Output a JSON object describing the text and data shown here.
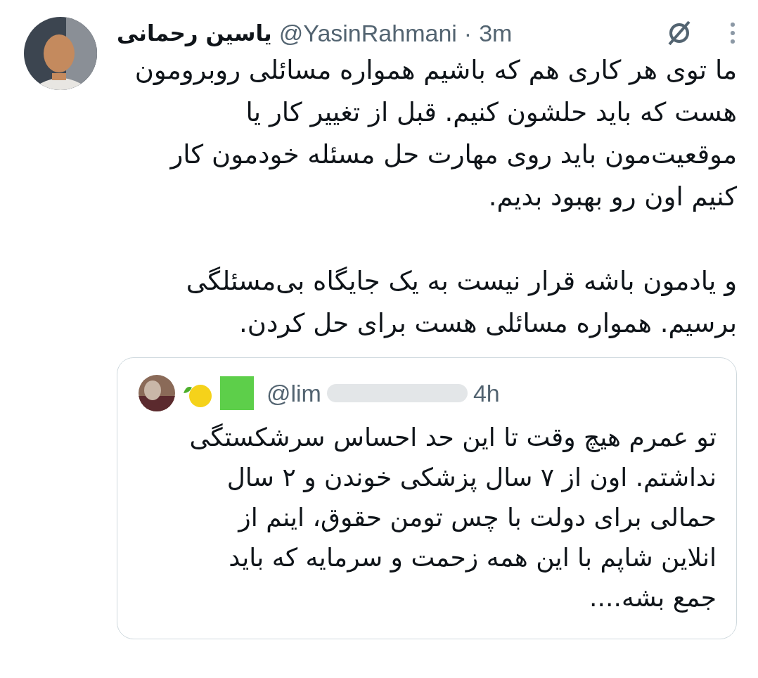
{
  "tweet": {
    "name": "یاسین رحمانی",
    "handle": "@YasinRahmani",
    "separator": "·",
    "time": "3m",
    "paragraphs": [
      "ما توی هر کاری هم که باشیم همواره مسائلی روبرومون\nهست که باید حلشون کنیم. قبل از تغییر کار یا\nموقعیت‌مون باید روی مهارت حل مسئله خودمون کار\nکنیم اون رو بهبود بدیم.",
      "و یادمون باشه قرار نیست به یک جایگاه بی‌مسئلگی\nبرسیم. همواره مسائلی هست برای حل کردن."
    ],
    "quoted": {
      "handle": "@lim",
      "time": "4h",
      "text": "تو عمرم هیچ وقت تا این حد احساس سرشکستگی\nنداشتم. اون از ۷ سال پزشکی خوندن و ۲ سال\nحمالی برای دولت با چس تومن حقوق، اینم از\nانلاین شاپم با این همه زحمت و سرمایه که باید\nجمع بشه...."
    }
  }
}
